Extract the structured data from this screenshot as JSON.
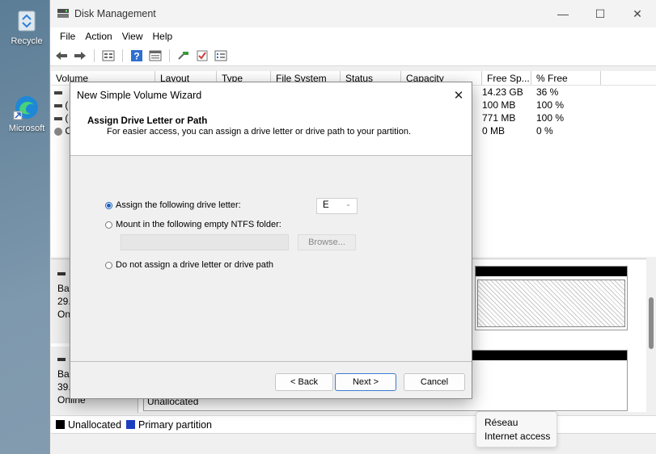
{
  "desktop": {
    "icons": [
      {
        "label": "Recycle",
        "icon": "recycle-bin-icon"
      },
      {
        "label": "Microsoft",
        "icon": "edge-browser-icon"
      }
    ]
  },
  "window": {
    "title": "Disk Management",
    "controls": {
      "minimize": "—",
      "maximize": "☐",
      "close": "✕"
    }
  },
  "menu": [
    "File",
    "Action",
    "View",
    "Help"
  ],
  "toolbar_icons": [
    "back-arrow-icon",
    "forward-arrow-icon",
    "disk-list-icon",
    "help-icon",
    "properties-icon",
    "connect-icon",
    "checklist-icon",
    "settings-list-icon"
  ],
  "volume_columns": [
    "Volume",
    "Layout",
    "Type",
    "File System",
    "Status",
    "Capacity",
    "Free Sp...",
    "% Free"
  ],
  "volume_rows": [
    {
      "volume": "",
      "free": "14.23 GB",
      "pct": "36 %"
    },
    {
      "volume": "(",
      "free": "100 MB",
      "pct": "100 %"
    },
    {
      "volume": "(",
      "free": "771 MB",
      "pct": "100 %"
    },
    {
      "volume": "C",
      "free": "0 MB",
      "pct": "0 %"
    }
  ],
  "disks": [
    {
      "line1": "Ba",
      "line2": "29.",
      "line3": "On"
    },
    {
      "line1": "Ba",
      "line2": "39.",
      "line3": "Online",
      "part_label": "Unallocated"
    }
  ],
  "legend": {
    "unallocated": "Unallocated",
    "primary": "Primary partition",
    "colors": {
      "unallocated": "#000000",
      "primary": "#1b3fbf"
    }
  },
  "network_tooltip": {
    "line1": "Réseau",
    "line2": "Internet access"
  },
  "wizard": {
    "title": "New Simple Volume Wizard",
    "close": "✕",
    "heading": "Assign Drive Letter or Path",
    "subheading": "For easier access, you can assign a drive letter or drive path to your partition.",
    "option_letter": "Assign the following drive letter:",
    "option_folder": "Mount in the following empty NTFS folder:",
    "option_none": "Do not assign a drive letter or drive path",
    "selected_letter": "E",
    "folder_value": "",
    "browse": "Browse...",
    "back": "< Back",
    "next": "Next >",
    "cancel": "Cancel"
  }
}
